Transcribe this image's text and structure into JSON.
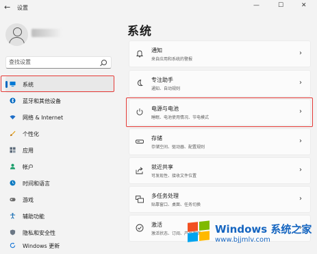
{
  "window": {
    "title": "设置",
    "back": "←",
    "min": "—",
    "max": "☐",
    "close": "✕"
  },
  "search": {
    "placeholder": "查找设置"
  },
  "sidebar": {
    "items": [
      {
        "label": "系统",
        "icon": "monitor-icon",
        "color": "#0078d4"
      },
      {
        "label": "蓝牙和其他设备",
        "icon": "bluetooth-icon",
        "color": "#0067c0"
      },
      {
        "label": "网络 & Internet",
        "icon": "wifi-icon",
        "color": "#1e6ec8"
      },
      {
        "label": "个性化",
        "icon": "brush-icon",
        "color": "#e3a21a"
      },
      {
        "label": "应用",
        "icon": "apps-icon",
        "color": "#5c6a7a"
      },
      {
        "label": "帐户",
        "icon": "account-icon",
        "color": "#1a9e6a"
      },
      {
        "label": "时间和语言",
        "icon": "globe-clock-icon",
        "color": "#0f7bc2"
      },
      {
        "label": "游戏",
        "icon": "gamepad-icon",
        "color": "#6b6b6b"
      },
      {
        "label": "辅助功能",
        "icon": "accessibility-icon",
        "color": "#1a6fb5"
      },
      {
        "label": "隐私和安全性",
        "icon": "shield-icon",
        "color": "#6b7785"
      },
      {
        "label": "Windows 更新",
        "icon": "update-icon",
        "color": "#1f7ad8"
      }
    ]
  },
  "main": {
    "title": "系统",
    "cards": [
      {
        "title": "通知",
        "subtitle": "来自应用和系统的警报",
        "icon": "bell-icon"
      },
      {
        "title": "专注助手",
        "subtitle": "通知、自动规则",
        "icon": "moon-icon"
      },
      {
        "title": "电源与电池",
        "subtitle": "睡眠、电池使用情况、节电模式",
        "icon": "power-icon"
      },
      {
        "title": "存储",
        "subtitle": "存储空间、驱动器、配置规则",
        "icon": "storage-icon"
      },
      {
        "title": "就近共享",
        "subtitle": "可发现性、接收文件位置",
        "icon": "share-icon"
      },
      {
        "title": "多任务处理",
        "subtitle": "贴靠窗口、桌面、任务切换",
        "icon": "multitask-icon"
      },
      {
        "title": "激活",
        "subtitle": "激活状态、订阅、产品密钥",
        "icon": "check-circle-icon"
      }
    ],
    "chevron": "›"
  },
  "watermark": {
    "line1": "Windows 系统之家",
    "line2": "www.bjjmlv.com"
  }
}
